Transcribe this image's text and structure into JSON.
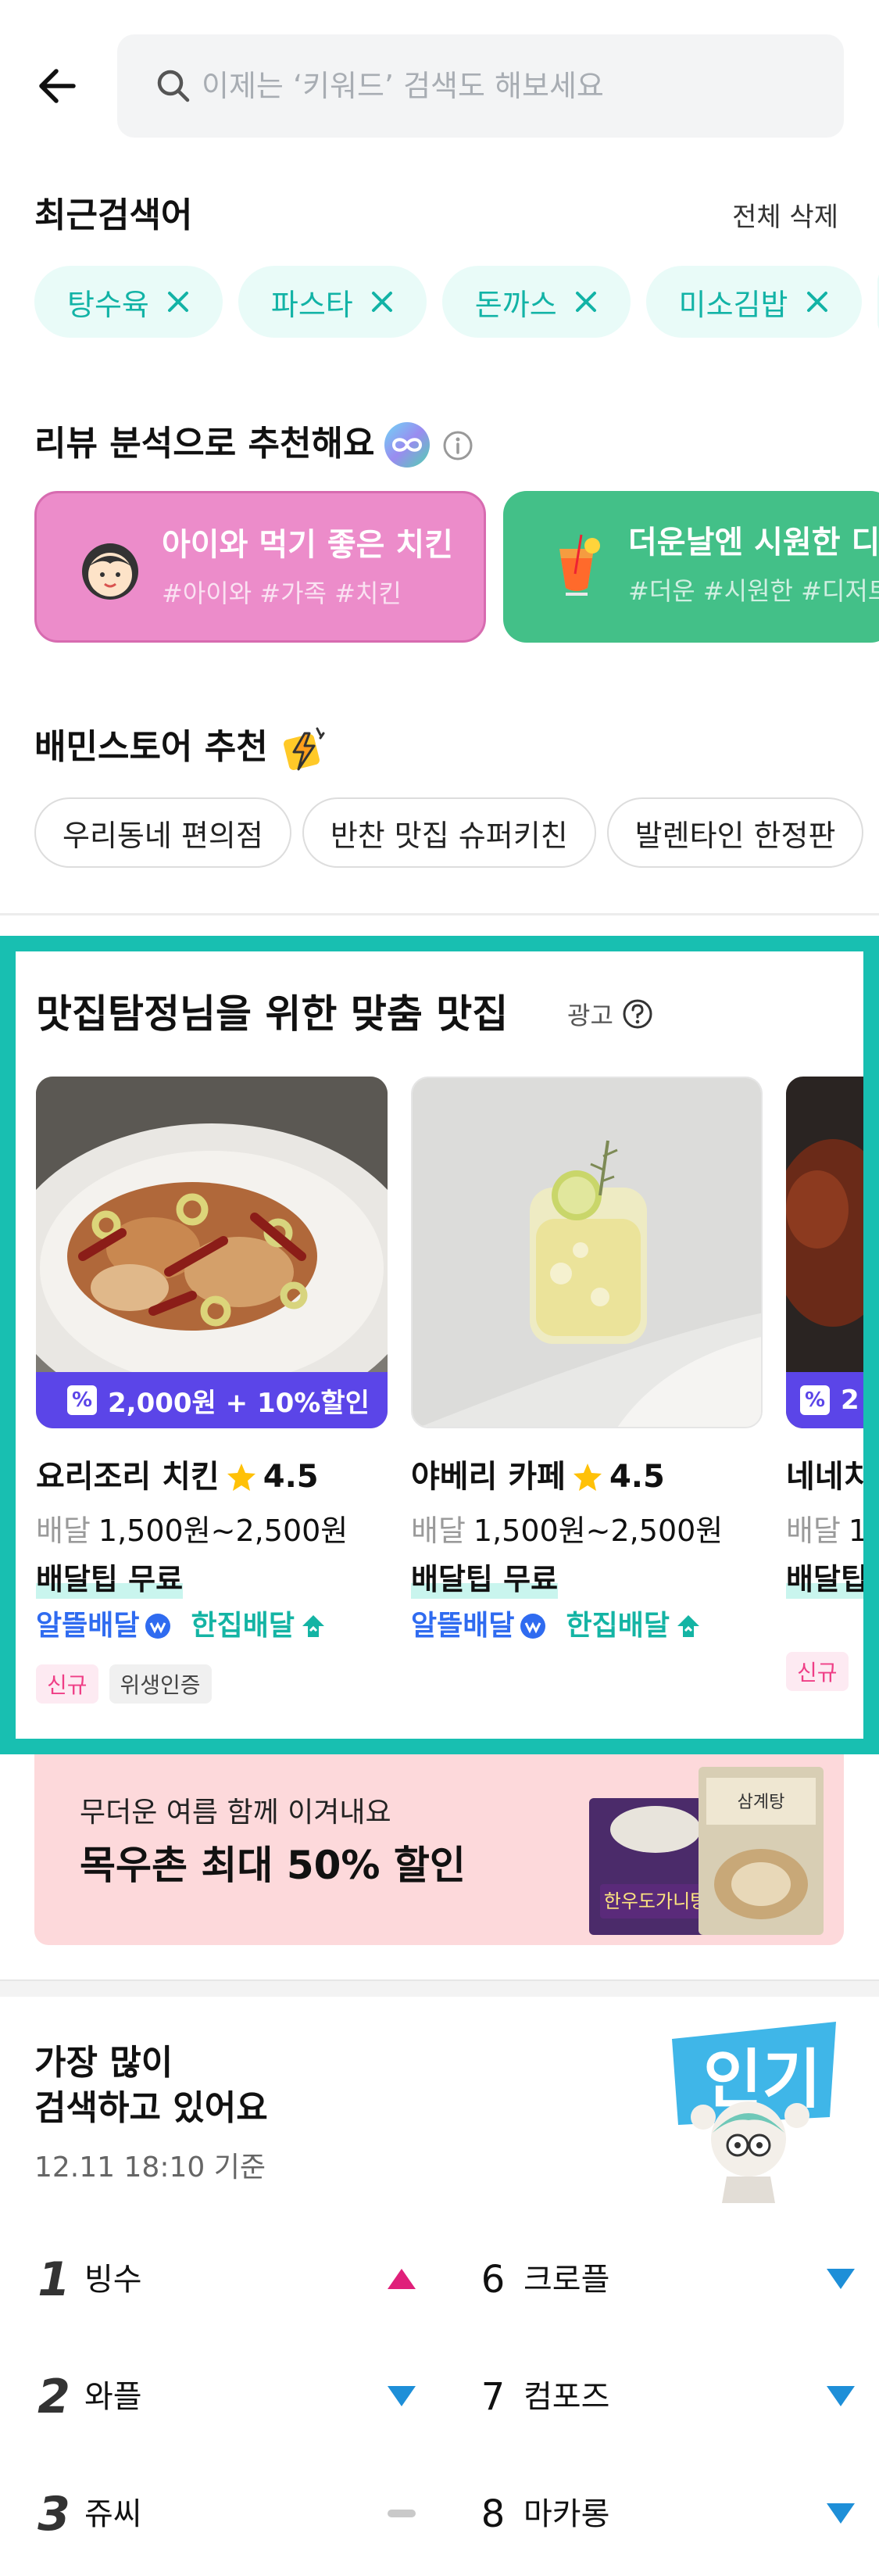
{
  "search": {
    "placeholder": "이제는 ‘키워드’ 검색도 해보세요"
  },
  "recent": {
    "title": "최근검색어",
    "delete_all": "전체 삭제",
    "chips": [
      "탕수육",
      "파스타",
      "돈까스",
      "미소김밥"
    ]
  },
  "review": {
    "title": "리뷰 분석으로 추천해요",
    "cards": [
      {
        "title": "아이와 먹기 좋은 치킨",
        "tags": "#아이와 #가족 #치킨",
        "icon": "child-face-icon",
        "color": "#ec8cca"
      },
      {
        "title": "더운날엔 시원한 디저트",
        "tags": "#더운 #시원한 #디저트",
        "icon": "cocktail-icon",
        "color": "#43c088"
      }
    ]
  },
  "store": {
    "title": "배민스토어 추천",
    "pills": [
      "우리동네 편의점",
      "반찬 맛집 슈퍼키친",
      "발렌타인 한정판"
    ]
  },
  "featured": {
    "title": "맛집탐정님을 위한 맞춤 맛집",
    "ad_label": "광고",
    "accent": "#18bfb1",
    "cards": [
      {
        "promo": "2,000원 + 10%할인",
        "name": "요리조리 치킨",
        "rating": "4.5",
        "delivery_label": "배달",
        "delivery_fee": "1,500원~2,500원",
        "tip": "배달팁 무료",
        "mode1": "알뜰배달",
        "mode2": "한집배달",
        "tags": [
          "신규",
          "위생인증"
        ]
      },
      {
        "name": "야베리 카페",
        "rating": "4.5",
        "delivery_label": "배달",
        "delivery_fee": "1,500원~2,500원",
        "tip": "배달팁 무료",
        "mode1": "알뜰배달",
        "mode2": "한집배달"
      },
      {
        "promo": "2",
        "name": "네네치",
        "delivery_label": "배달",
        "delivery_fee": "1",
        "tip": "배달팁",
        "tags": [
          "신규"
        ]
      }
    ]
  },
  "banner": {
    "line1": "무더운 여름 함께 이겨내요",
    "line2": "목우촌 최대 50% 할인",
    "product_text1": "한우도가니탕",
    "product_text2": "삼계탕"
  },
  "popular": {
    "title_line1": "가장 많이",
    "title_line2": "검색하고 있어요",
    "timestamp": "12.11 18:10 기준",
    "badge": "인기",
    "ranks": [
      {
        "rank": "1",
        "word": "빙수",
        "trend": "up"
      },
      {
        "rank": "2",
        "word": "와플",
        "trend": "down"
      },
      {
        "rank": "3",
        "word": "쥬씨",
        "trend": "same"
      },
      {
        "rank": "6",
        "word": "크로플",
        "trend": "down"
      },
      {
        "rank": "7",
        "word": "컴포즈",
        "trend": "down"
      },
      {
        "rank": "8",
        "word": "마카롱",
        "trend": "down"
      }
    ]
  }
}
